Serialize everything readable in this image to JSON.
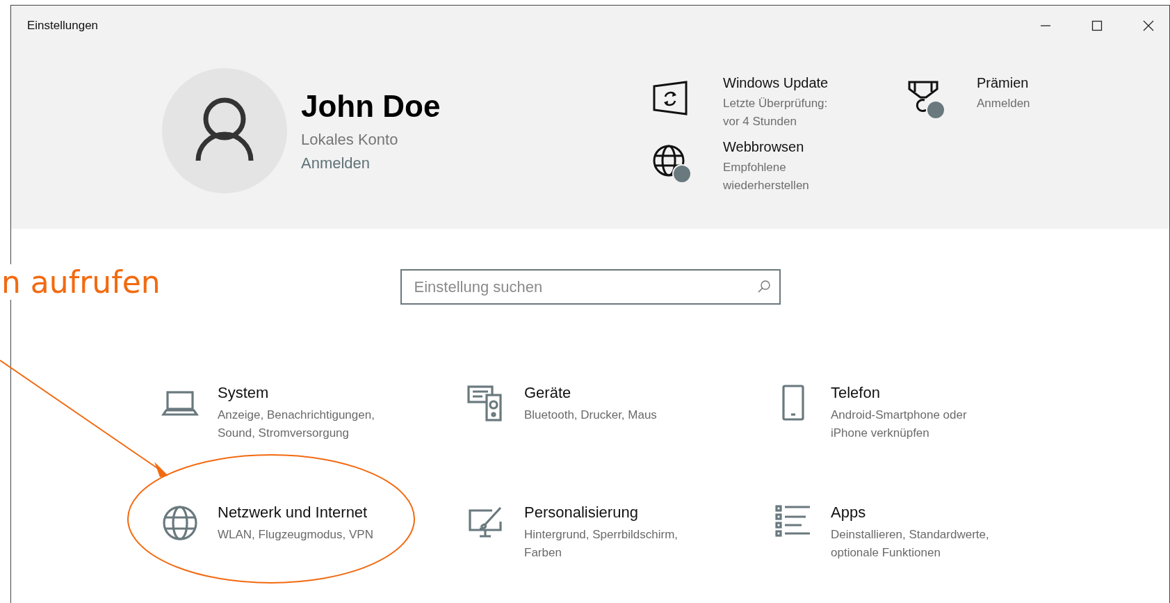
{
  "window": {
    "title": "Einstellungen"
  },
  "account": {
    "name": "John Doe",
    "type": "Lokales Konto",
    "link": "Anmelden"
  },
  "shortcuts": [
    {
      "kind": "update",
      "title": "Windows Update",
      "subtitle": "Letzte Überprüfung:\nvor 4 Stunden",
      "badge": false
    },
    {
      "kind": "rewards",
      "title": "Prämien",
      "subtitle": "Anmelden",
      "badge": true
    },
    {
      "kind": "browser",
      "title": "Webbrowsen",
      "subtitle": "Empfohlene\nwiederherstellen",
      "badge": true
    }
  ],
  "search": {
    "placeholder": "Einstellung suchen"
  },
  "categories": [
    {
      "kind": "system",
      "title": "System",
      "description": "Anzeige, Benachrichtigungen,\nSound, Stromversorgung"
    },
    {
      "kind": "devices",
      "title": "Geräte",
      "description": "Bluetooth, Drucker, Maus"
    },
    {
      "kind": "phone",
      "title": "Telefon",
      "description": "Android-Smartphone oder\niPhone verknüpfen"
    },
    {
      "kind": "network",
      "title": "Netzwerk und Internet",
      "description": "WLAN, Flugzeugmodus, VPN"
    },
    {
      "kind": "personalization",
      "title": "Personalisierung",
      "description": "Hintergrund, Sperrbildschirm,\nFarben"
    },
    {
      "kind": "apps",
      "title": "Apps",
      "description": "Deinstallieren, Standardwerte,\noptionale Funktionen"
    }
  ],
  "annotation": {
    "text": "n aufrufen"
  }
}
